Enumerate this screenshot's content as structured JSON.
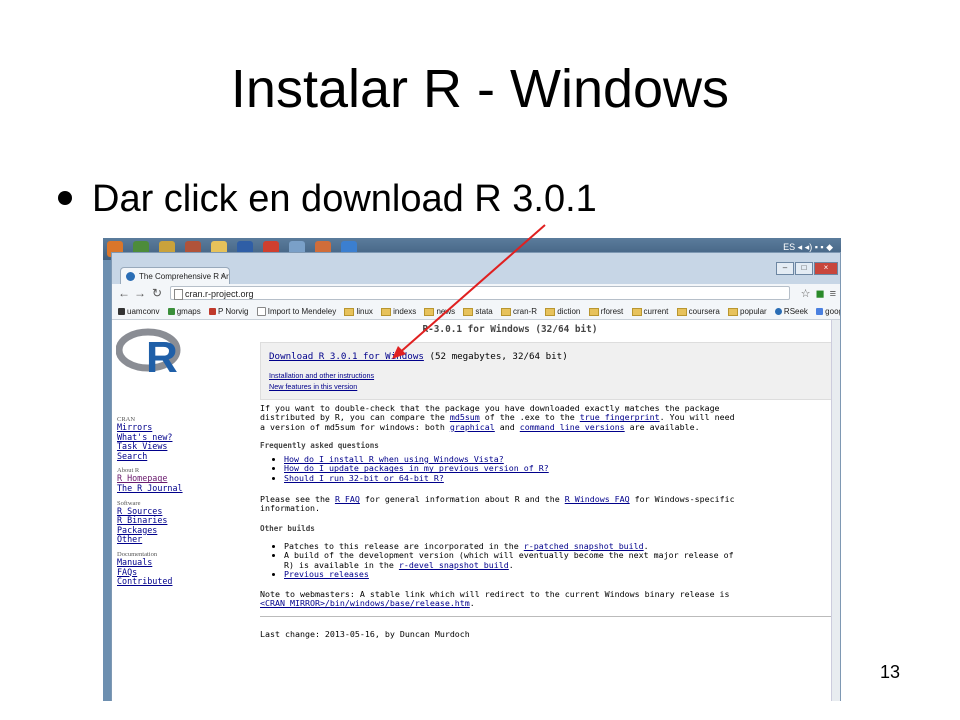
{
  "slide": {
    "title": "Instalar R - Windows",
    "bullet": "Dar click en download R 3.0.1",
    "page_number": "13"
  },
  "taskbar": {
    "lang": "ES"
  },
  "browser": {
    "tab_title": "The Comprehensive R Arc",
    "url": "cran.r-project.org",
    "bookmarks": [
      "uamconv",
      "gmaps",
      "P Norvig",
      "Import to Mendeley",
      "linux",
      "indexs",
      "news",
      "stata",
      "cran-R",
      "diction",
      "rforest",
      "current",
      "coursera",
      "popular",
      "RSeek",
      "google"
    ]
  },
  "sidebar": {
    "cran_heading": "CRAN",
    "cran_links": [
      "Mirrors",
      "What's new?",
      "Task Views",
      "Search"
    ],
    "about_heading": "About R",
    "about_links": [
      "R Homepage",
      "The R Journal"
    ],
    "software_heading": "Software",
    "software_links": [
      "R Sources",
      "R Binaries",
      "Packages",
      "Other"
    ],
    "docs_heading": "Documentation",
    "docs_links": [
      "Manuals",
      "FAQs",
      "Contributed"
    ]
  },
  "main": {
    "heading": "R-3.0.1 for Windows (32/64 bit)",
    "download_link": "Download R 3.0.1 for Windows",
    "download_size": "(52 megabytes, 32/64 bit)",
    "install_link": "Installation and other instructions",
    "features_link": "New features in this version",
    "check_1": "If you want to double-check that the package you have downloaded exactly matches the package",
    "check_2a": "distributed by R, you can compare the ",
    "check_md5": "md5sum",
    "check_2b": " of the .exe to the ",
    "check_fp": "true fingerprint",
    "check_2c": ". You will need",
    "check_3a": "a version of md5sum for windows: both ",
    "check_graphical": "graphical",
    "check_3b": " and ",
    "check_cmd": "command line versions",
    "check_3c": " are available.",
    "faq_heading": "Frequently asked questions",
    "faq_items": [
      "How do I install R when using Windows Vista?",
      "How do I update packages in my previous version of R?",
      "Should I run 32-bit or 64-bit R?"
    ],
    "see_1a": "Please see the ",
    "see_rfaq": "R FAQ",
    "see_1b": " for general information about R and the ",
    "see_wfaq": "R Windows FAQ",
    "see_1c": " for Windows-specific",
    "see_2": "information.",
    "other_heading": "Other builds",
    "other_1a": "Patches to this release are incorporated in the ",
    "other_1link": "r-patched snapshot build",
    "other_1b": ".",
    "other_2a": "A build of the development version (which will eventually become the next major release of",
    "other_2b": "R) is available in the ",
    "other_2link": "r-devel snapshot build",
    "other_2c": ".",
    "other_3": "Previous releases",
    "webmaster_1": "Note to webmasters: A stable link which will redirect to the current Windows binary release is",
    "webmaster_link": "<CRAN MIRROR>/bin/windows/base/release.htm",
    "webmaster_2": ".",
    "last_change": "Last change: 2013-05-16, by Duncan Murdoch"
  },
  "colors": {
    "link": "#00008b",
    "visited": "#6a1b6e",
    "arrow": "#e02020"
  }
}
